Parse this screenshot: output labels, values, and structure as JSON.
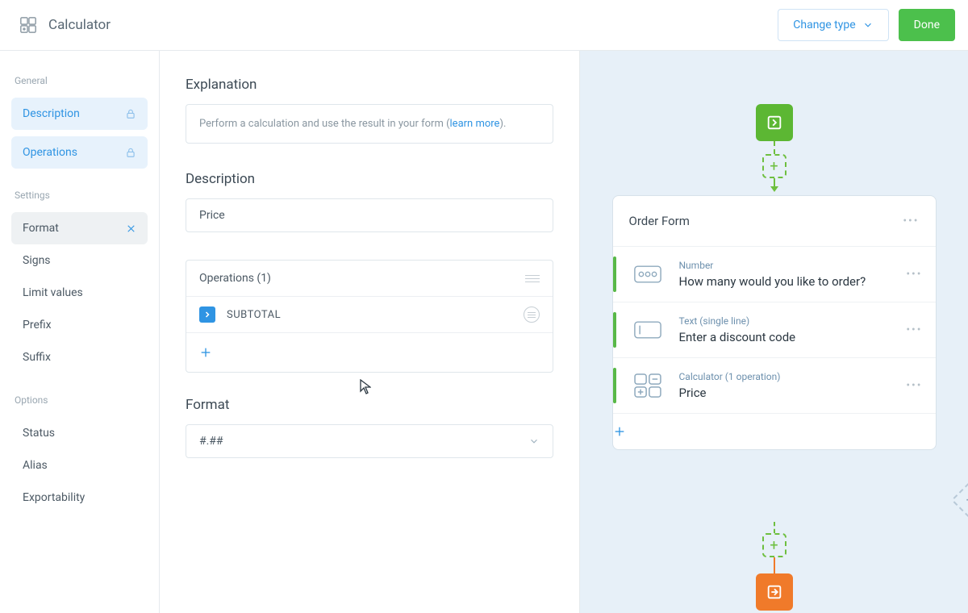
{
  "header": {
    "title": "Calculator",
    "change_type": "Change type",
    "done": "Done"
  },
  "sidebar": {
    "groups": [
      {
        "label": "General",
        "items": [
          {
            "label": "Description",
            "locked": true
          },
          {
            "label": "Operations",
            "locked": true
          }
        ]
      },
      {
        "label": "Settings",
        "items": [
          {
            "label": "Format",
            "closable": true
          },
          {
            "label": "Signs"
          },
          {
            "label": "Limit values"
          },
          {
            "label": "Prefix"
          },
          {
            "label": "Suffix"
          }
        ]
      },
      {
        "label": "Options",
        "items": [
          {
            "label": "Status"
          },
          {
            "label": "Alias"
          },
          {
            "label": "Exportability"
          }
        ]
      }
    ]
  },
  "editor": {
    "explanation_title": "Explanation",
    "explanation_text_pre": "Perform a calculation and use the result in your form (",
    "explanation_link": "learn more",
    "explanation_text_post": ").",
    "description_title": "Description",
    "description_value": "Price",
    "operations_title": "Operations (1)",
    "operation_name": "SUBTOTAL",
    "format_title": "Format",
    "format_value": "#.##"
  },
  "preview": {
    "form_title": "Order Form",
    "fields": [
      {
        "type": "Number",
        "label": "How many would you like to order?"
      },
      {
        "type": "Text (single line)",
        "label": "Enter a discount code"
      },
      {
        "type": "Calculator (1 operation)",
        "label": "Price"
      }
    ]
  }
}
